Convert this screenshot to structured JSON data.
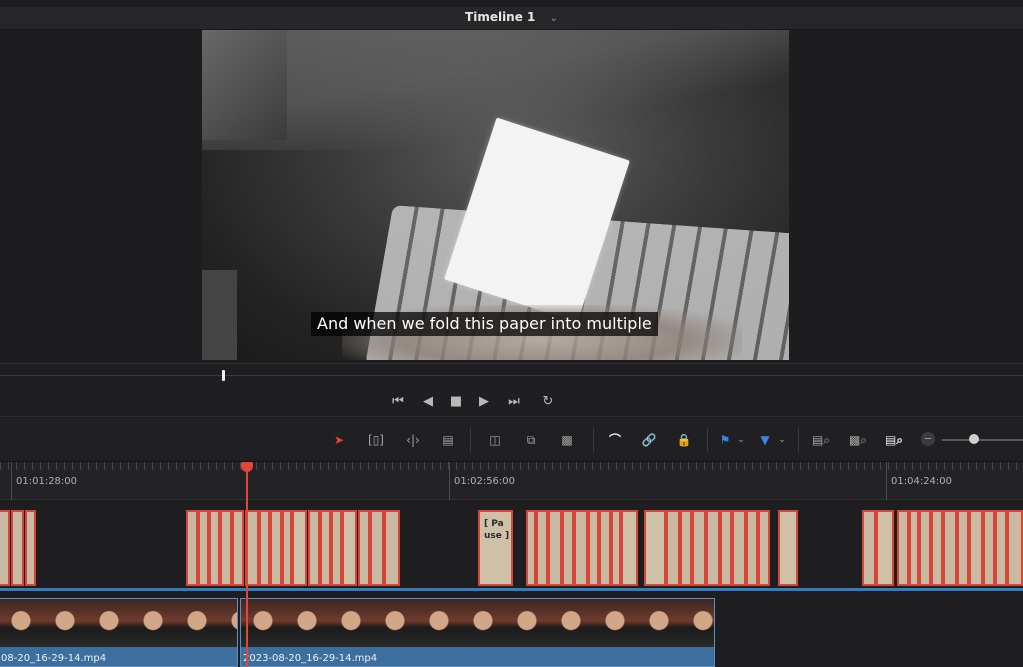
{
  "viewer": {
    "timeline_name": "Timeline 1",
    "subtitle_text": "And when we fold this paper into multiple"
  },
  "transport": {
    "icons": [
      "skip-to-start-icon",
      "play-reverse-icon",
      "stop-icon",
      "play-icon",
      "skip-to-end-icon",
      "loop-icon"
    ]
  },
  "toolbar": {
    "icons": [
      "selection-pointer-icon",
      "trim-edit-icon",
      "dynamic-trim-icon",
      "blade-icon",
      "insert-clip-icon",
      "overwrite-clip-icon",
      "replace-clip-icon",
      "snapping-icon",
      "linked-selection-icon",
      "position-lock-icon",
      "flag-icon",
      "marker-icon",
      "zoom-full-icon",
      "zoom-detail-icon",
      "zoom-custom-icon"
    ],
    "accent_red": "#e2463a",
    "accent_blue": "#3b82e6"
  },
  "ruler": {
    "timecodes": [
      "01:01:28:00",
      "01:02:56:00",
      "01:04:24:00"
    ]
  },
  "tracks": {
    "pause_clip_text": "[ Pa use ]",
    "video_clips": [
      {
        "name": "08-20_16-29-14.mp4"
      },
      {
        "name": "2023-08-20_16-29-14.mp4"
      }
    ]
  }
}
